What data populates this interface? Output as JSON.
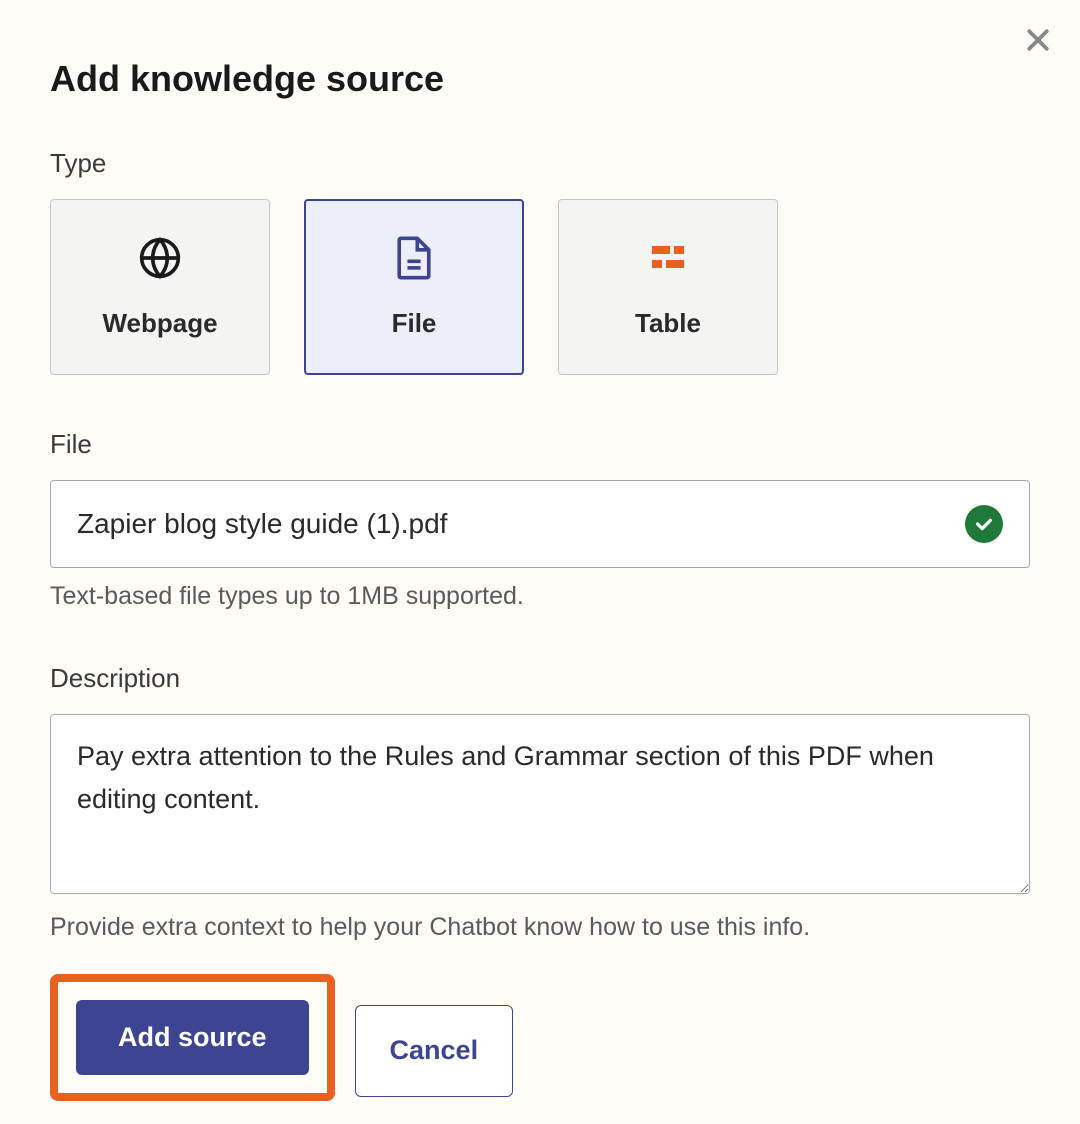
{
  "modal": {
    "title": "Add knowledge source",
    "close_label": "Close"
  },
  "type_section": {
    "label": "Type",
    "options": [
      {
        "id": "webpage",
        "label": "Webpage"
      },
      {
        "id": "file",
        "label": "File"
      },
      {
        "id": "table",
        "label": "Table"
      }
    ],
    "selected": "file"
  },
  "file_section": {
    "label": "File",
    "filename": "Zapier blog style guide (1).pdf",
    "status": "success",
    "help_text": "Text-based file types up to 1MB supported."
  },
  "description_section": {
    "label": "Description",
    "value": "Pay extra attention to the Rules and Grammar section of this PDF when editing content.",
    "help_text": "Provide extra context to help your Chatbot know how to use this info."
  },
  "actions": {
    "primary": "Add source",
    "secondary": "Cancel"
  }
}
